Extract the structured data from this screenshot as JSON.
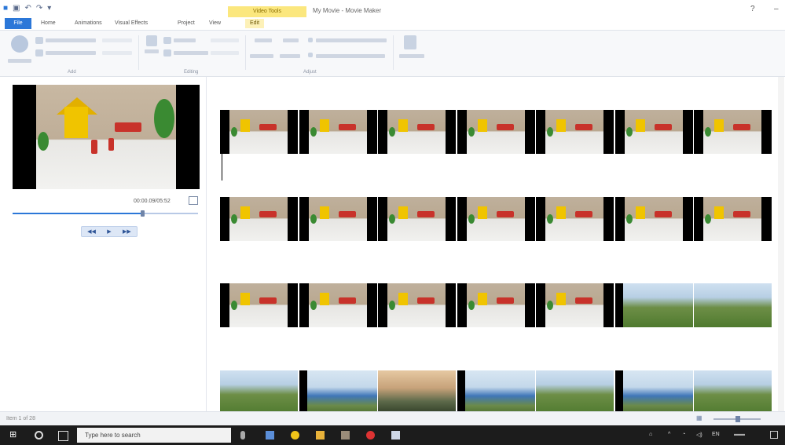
{
  "window": {
    "context_tab": "Video Tools",
    "doc_title": "My Movie - Movie Maker",
    "help": "?",
    "minimize": "–"
  },
  "tabs": [
    {
      "label": "File"
    },
    {
      "label": "Home"
    },
    {
      "label": "Animations"
    },
    {
      "label": "Visual Effects"
    },
    {
      "label": "Project"
    },
    {
      "label": "View"
    },
    {
      "label": "Edit"
    }
  ],
  "ribbon_groups": [
    "Add",
    "Editing",
    "Adjust"
  ],
  "preview": {
    "timecode": "00:00.09/05:52",
    "progress": 0.7,
    "controls": [
      "◀◀",
      "▶",
      "▶▶"
    ]
  },
  "status": {
    "text": "Item 1 of 28"
  },
  "taskbar": {
    "search_placeholder": "Type here to search"
  },
  "colors": {
    "accent": "#2b77d8",
    "context_tab": "#fbe77e",
    "taskbar": "#1c1c1c"
  }
}
